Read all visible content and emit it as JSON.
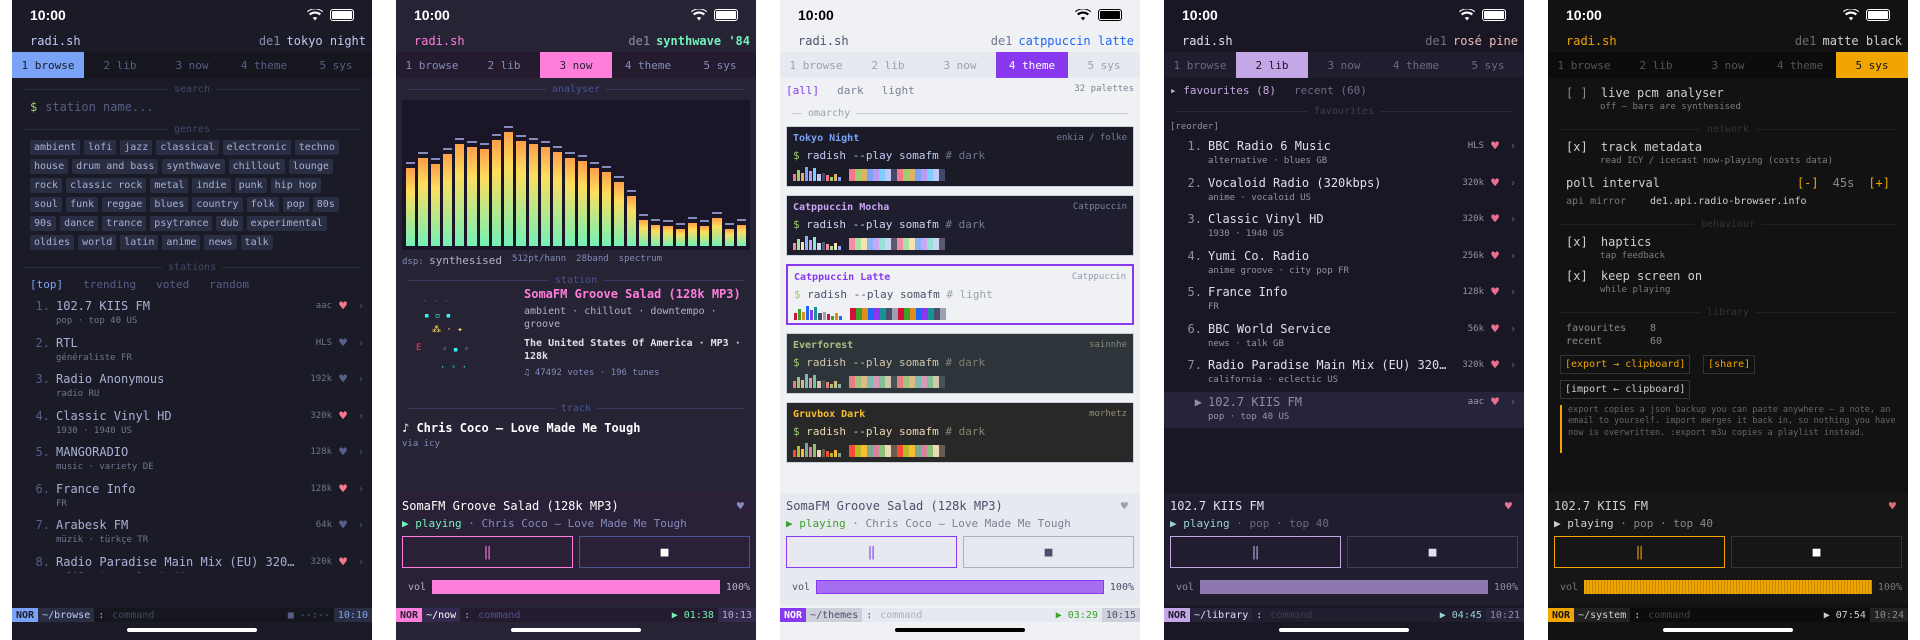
{
  "status_bar": {
    "time": "10:00"
  },
  "app_name": "radi.sh",
  "tabs": [
    "1 browse",
    "2 lib",
    "3 now",
    "4 theme",
    "5 sys"
  ],
  "screens": {
    "browse": {
      "host": "de1",
      "theme": "tokyo night",
      "search_section": "search",
      "search_prompt": "$",
      "search_placeholder": "station name...",
      "genres_section": "genres",
      "genres": [
        "ambient",
        "lofi",
        "jazz",
        "classical",
        "electronic",
        "techno",
        "house",
        "drum and bass",
        "synthwave",
        "chillout",
        "lounge",
        "rock",
        "classic rock",
        "metal",
        "indie",
        "punk",
        "hip hop",
        "soul",
        "funk",
        "reggae",
        "blues",
        "country",
        "folk",
        "pop",
        "80s",
        "90s",
        "dance",
        "trance",
        "psytrance",
        "dub",
        "experimental",
        "oldies",
        "world",
        "latin",
        "anime",
        "news",
        "talk"
      ],
      "stations_section": "stations",
      "filters": [
        "[top]",
        "trending",
        "voted",
        "random"
      ],
      "stations": [
        {
          "n": "1.",
          "name": "102.7 KIIS FM",
          "tags": "pop · top 40  US",
          "bitrate": "aac",
          "fav": true
        },
        {
          "n": "2.",
          "name": "RTL",
          "tags": "généraliste  FR",
          "bitrate": "HLS",
          "fav": false
        },
        {
          "n": "3.",
          "name": "Radio Anonymous",
          "tags": "radio  RU",
          "bitrate": "192k",
          "fav": false
        },
        {
          "n": "4.",
          "name": "Classic Vinyl HD",
          "tags": "1930 · 1940  US",
          "bitrate": "320k",
          "fav": true
        },
        {
          "n": "5.",
          "name": "MANGORADIO",
          "tags": "music · variety  DE",
          "bitrate": "128k",
          "fav": false
        },
        {
          "n": "6.",
          "name": "France Info",
          "tags": "FR",
          "bitrate": "128k",
          "fav": true
        },
        {
          "n": "7.",
          "name": "Arabesk FM",
          "tags": "müzik · türkçe  TR",
          "bitrate": "64k",
          "fav": false
        },
        {
          "n": "8.",
          "name": "Radio Paradise Main Mix (EU) 320…",
          "tags": "california · eclectic  US",
          "bitrate": "320k",
          "fav": true
        }
      ],
      "mode": "NOR",
      "path": "~/browse",
      "cmd_prompt": ":",
      "cmd_placeholder": "command",
      "play_state": "■ --:--",
      "clock": "10:10"
    },
    "now": {
      "host": "de1",
      "theme": "synthwave '84",
      "analyser_section": "analyser",
      "analyser_levels": [
        0.55,
        0.62,
        0.58,
        0.65,
        0.72,
        0.7,
        0.68,
        0.75,
        0.8,
        0.74,
        0.72,
        0.7,
        0.66,
        0.62,
        0.6,
        0.55,
        0.52,
        0.45,
        0.35,
        0.18,
        0.15,
        0.14,
        0.12,
        0.16,
        0.14,
        0.2,
        0.12,
        0.15
      ],
      "dsp_label": "dsp:",
      "dsp_value": "synthesised",
      "dsp_fft": "512pt/hann",
      "dsp_bands": "28band",
      "dsp_view": "spectrum",
      "station_section": "station",
      "station_name": "SomaFM Groove Salad (128k MP3)",
      "station_tags": "ambient · chillout · downtempo · groove",
      "station_meta": "The United States Of America · MP3 · 128k",
      "station_votes": "♫ 47492 votes · 196 tunes",
      "track_section": "track",
      "track_title": "♪ Chris Coco — Love Made Me Tough",
      "track_via": "via icy",
      "np_station": "SomaFM Groove Salad (128k MP3)",
      "np_state": "▶ playing",
      "np_track": "· Chris Coco — Love Made Me Tough",
      "vol_label": "vol",
      "vol_level": 1.0,
      "vol_value": "100%",
      "mode": "NOR",
      "path": "~/now",
      "cmd_prompt": ":",
      "cmd_placeholder": "command",
      "elapsed": "▶ 01:38",
      "clock": "10:13"
    },
    "theme": {
      "host": "de1",
      "theme": "catppuccin latte",
      "filters": [
        "[all]",
        "dark",
        "light"
      ],
      "count": "32 palettes",
      "group_section": "omarchy",
      "palettes": [
        {
          "name": "Tokyo Night",
          "author": "enkia / folke",
          "cmd": "radish --play somafm",
          "mode": "# dark",
          "selected": false,
          "bg": "#1a1b26",
          "fg": "#c0caf5",
          "accent": "#7aa2f7",
          "sw": [
            "#f7768e",
            "#9ece6a",
            "#e0af68",
            "#7aa2f7",
            "#bb9af7",
            "#7dcfff",
            "#c0caf5",
            "#414868"
          ]
        },
        {
          "name": "Catppuccin Mocha",
          "author": "Catppuccin",
          "cmd": "radish --play somafm",
          "mode": "# dark",
          "selected": false,
          "bg": "#1e1e2e",
          "fg": "#cdd6f4",
          "accent": "#cba6f7",
          "sw": [
            "#f38ba8",
            "#a6e3a1",
            "#f9e2af",
            "#89b4fa",
            "#cba6f7",
            "#94e2d5",
            "#cdd6f4",
            "#585b70"
          ]
        },
        {
          "name": "Catppuccin Latte",
          "author": "Catppuccin",
          "cmd": "radish --play somafm",
          "mode": "# light",
          "selected": true,
          "bg": "#eff1f5",
          "fg": "#4c4f69",
          "accent": "#8839ef",
          "sw": [
            "#d20f39",
            "#40a02b",
            "#df8e1d",
            "#1e66f5",
            "#8839ef",
            "#179299",
            "#4c4f69",
            "#9ca0b0"
          ]
        },
        {
          "name": "Everforest",
          "author": "sainnhe",
          "cmd": "radish --play somafm",
          "mode": "# dark",
          "selected": false,
          "bg": "#2d353b",
          "fg": "#d3c6aa",
          "accent": "#a7c080",
          "sw": [
            "#e67e80",
            "#a7c080",
            "#dbbc7f",
            "#7fbbb3",
            "#d699b6",
            "#83c092",
            "#d3c6aa",
            "#475258"
          ]
        },
        {
          "name": "Gruvbox Dark",
          "author": "morhetz",
          "cmd": "radish --play somafm",
          "mode": "# dark",
          "selected": false,
          "bg": "#282828",
          "fg": "#ebdbb2",
          "accent": "#fabd2f",
          "sw": [
            "#fb4934",
            "#b8bb26",
            "#fabd2f",
            "#83a598",
            "#d3869b",
            "#8ec07c",
            "#ebdbb2",
            "#665c54"
          ]
        }
      ],
      "np_station": "SomaFM Groove Salad (128k MP3)",
      "np_state": "▶ playing",
      "np_track": "· Chris Coco — Love Made Me Tough",
      "vol_label": "vol",
      "vol_level": 1.0,
      "vol_value": "100%",
      "mode": "NOR",
      "path": "~/themes",
      "cmd_prompt": ":",
      "cmd_placeholder": "command",
      "elapsed": "▶ 03:29",
      "clock": "10:15"
    },
    "lib": {
      "host": "de1",
      "theme": "rosé pine",
      "subtabs": [
        "▸ favourites (8)",
        "recent (60)"
      ],
      "fav_section": "favourites",
      "reorder": "[reorder]",
      "items": [
        {
          "n": "1.",
          "name": "BBC Radio 6 Music",
          "tags": "alternative · blues  GB",
          "bitrate": "HLS"
        },
        {
          "n": "2.",
          "name": "Vocaloid Radio (320kbps)",
          "tags": "anime · vocaloid  US",
          "bitrate": "320k"
        },
        {
          "n": "3.",
          "name": "Classic Vinyl HD",
          "tags": "1930 · 1940  US",
          "bitrate": "320k"
        },
        {
          "n": "4.",
          "name": "Yumi Co. Radio",
          "tags": "anime groove · city pop  FR",
          "bitrate": "256k"
        },
        {
          "n": "5.",
          "name": "France Info",
          "tags": "FR",
          "bitrate": "128k"
        },
        {
          "n": "6.",
          "name": "BBC World Service",
          "tags": "news · talk  GB",
          "bitrate": "56k"
        },
        {
          "n": "7.",
          "name": "Radio Paradise Main Mix (EU) 320…",
          "tags": "california · eclectic  US",
          "bitrate": "320k"
        },
        {
          "n": "▶",
          "name": "102.7 KIIS FM",
          "tags": "pop · top 40  US",
          "bitrate": "aac"
        }
      ],
      "np_station": "102.7 KIIS FM",
      "np_state": "▶ playing",
      "np_track": "· pop · top 40",
      "vol_label": "vol",
      "vol_level": 1.0,
      "vol_value": "100%",
      "mode": "NOR",
      "path": "~/library",
      "cmd_prompt": ":",
      "cmd_placeholder": "command",
      "elapsed": "▶ 04:45",
      "clock": "10:21"
    },
    "sys": {
      "host": "de1",
      "theme": "matte black",
      "pcm_check": "[ ]",
      "pcm_label": "live pcm analyser",
      "pcm_sub": "off — bars are synthesised",
      "network_section": "network",
      "meta_check": "[x]",
      "meta_label": "track metadata",
      "meta_sub": "read ICY / icecast now-playing (costs data)",
      "poll_label": "poll interval",
      "poll_minus": "[-]",
      "poll_value": "45s",
      "poll_plus": "[+]",
      "mirror_label": "api mirror",
      "mirror_value": "de1.api.radio-browser.info",
      "behaviour_section": "behaviour",
      "haptics_check": "[x]",
      "haptics_label": "haptics",
      "haptics_sub": "tap feedback",
      "awake_check": "[x]",
      "awake_label": "keep screen on",
      "awake_sub": "while playing",
      "library_section": "library",
      "fav_label": "favourites",
      "fav_count": "8",
      "recent_label": "recent",
      "recent_count": "60",
      "export_btn": "[export → clipboard]",
      "share_btn": "[share]",
      "import_btn": "[import ← clipboard]",
      "note": "export copies a json backup you can paste anywhere — a note, an email to yourself. import merges it back in, so nothing you have now is overwritten. :export m3u copies a playlist instead.",
      "np_station": "102.7 KIIS FM",
      "np_state": "▶ playing",
      "np_track": "· pop · top 40",
      "vol_label": "vol",
      "vol_level": 1.0,
      "vol_value": "100%",
      "mode": "NOR",
      "path": "~/system",
      "cmd_prompt": ":",
      "cmd_placeholder": "command",
      "elapsed": "▶ 07:54",
      "clock": "10:24"
    }
  },
  "colors": {
    "tokyo_bg": "#1a1b26",
    "tokyo_accent": "#7aa2f7",
    "tokyo_heart": "#f7768e",
    "synth_bg": "#262335",
    "synth_accent": "#ff7edb",
    "synth_title": "#f97e72",
    "latte_bg": "#eff1f5",
    "latte_accent": "#8839ef",
    "rose_bg": "#191724",
    "rose_accent": "#c4a7e7",
    "rose_heart": "#eb6f92",
    "matte_bg": "#121212",
    "matte_accent": "#f0a500"
  }
}
